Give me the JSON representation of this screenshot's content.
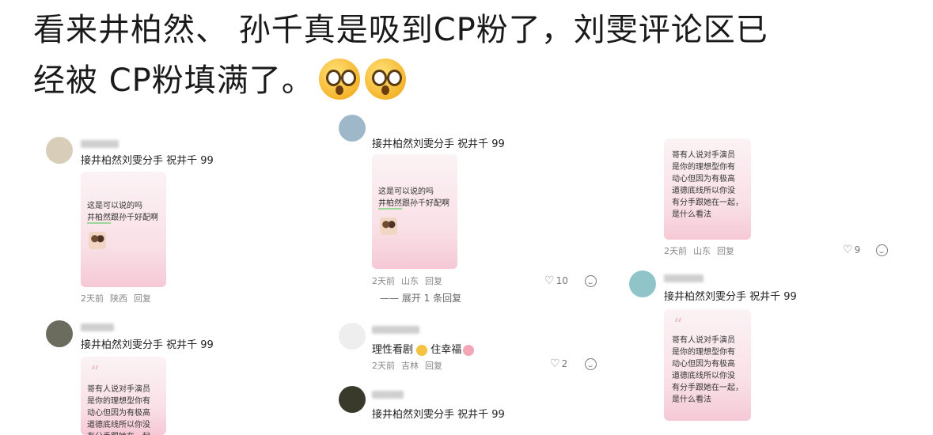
{
  "caption": {
    "line1": "看来井柏然、 孙千真是吸到CP粉了，刘雯评论区已",
    "line2": "经被 CP粉填满了。",
    "emoji": [
      "flushed-face-emoji",
      "flushed-face-emoji"
    ]
  },
  "comment_text": "接井柏然刘雯分手 祝井千 99",
  "card1": {
    "line1": "这是可以说的吗",
    "line2_hl": "井柏然",
    "line2_rest": "跟孙千好配啊"
  },
  "card2": {
    "para": "哥有人说对手演员\n是你的理想型你有\n动心但因为有极高\n道德底线所以你没\n有分手跟她在一起，\n是什么看法"
  },
  "col1": {
    "c1": {
      "text": "接井柏然刘雯分手 祝井千 99",
      "time": "2天前",
      "place": "陕西",
      "reply": "回复"
    },
    "c2": {
      "text": "接井柏然刘雯分手 祝井千 99"
    }
  },
  "col2": {
    "c0": {
      "text": "接井柏然刘雯分手 祝井千 99"
    },
    "c1": {
      "time": "2天前",
      "place": "山东",
      "reply": "回复",
      "likes": "10"
    },
    "expand": "展开 1 条回复",
    "c2": {
      "text": "理性看剧",
      "emoji_text": "住幸福",
      "time": "2天前",
      "place": "吉林",
      "reply": "回复",
      "likes": "2"
    },
    "c3": {
      "text": "接井柏然刘雯分手 祝井千 99"
    }
  },
  "col3": {
    "c1": {
      "time": "2天前",
      "place": "山东",
      "reply": "回复",
      "likes": "9"
    },
    "c2": {
      "text": "接井柏然刘雯分手 祝井千 99"
    }
  },
  "colors": {
    "card_pink": "#f9e0e7",
    "highlight_green": "#9bd79b"
  }
}
